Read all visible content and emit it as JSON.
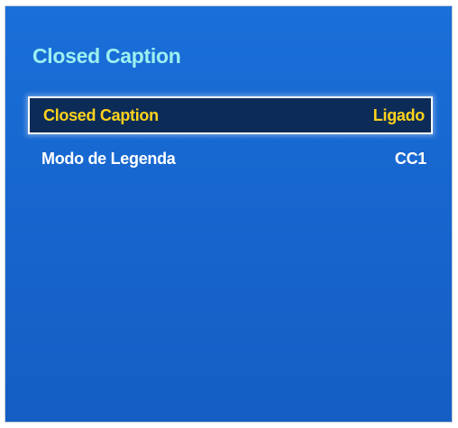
{
  "panel": {
    "title": "Closed Caption"
  },
  "menu": {
    "items": [
      {
        "label": "Closed Caption",
        "value": "Ligado",
        "selected": true
      },
      {
        "label": "Modo de Legenda",
        "value": "CC1",
        "selected": false
      }
    ]
  },
  "colors": {
    "panel_background": "#1766cf",
    "title_text": "#9cf0f0",
    "selected_background": "#0c2c57",
    "selected_text": "#ffd21a",
    "normal_text": "#ffffff"
  }
}
